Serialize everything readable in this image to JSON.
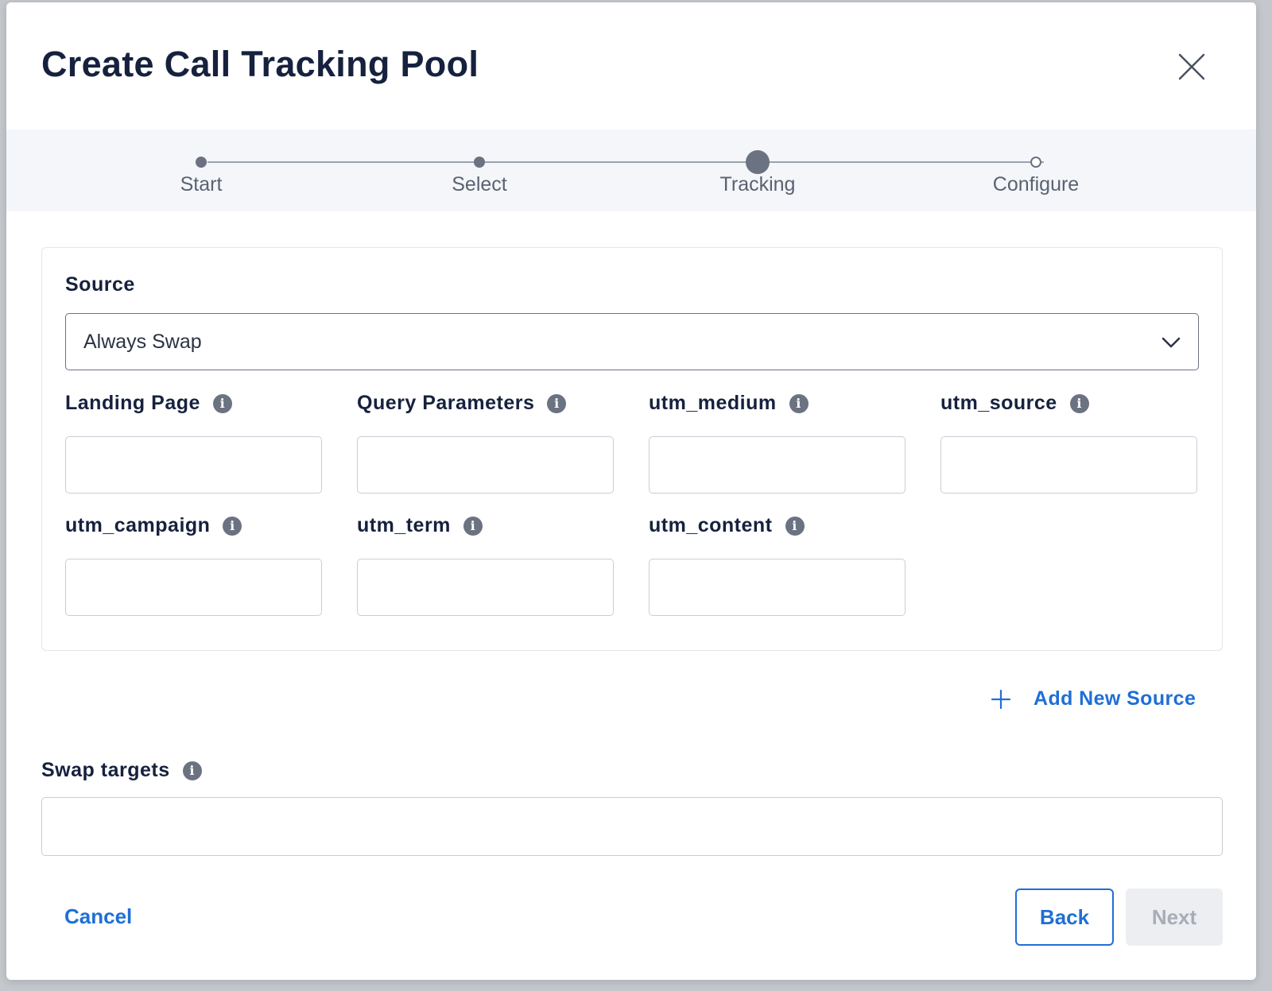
{
  "modal": {
    "title": "Create Call Tracking Pool"
  },
  "stepper": {
    "steps": [
      {
        "label": "Start",
        "state": "done"
      },
      {
        "label": "Select",
        "state": "done"
      },
      {
        "label": "Tracking",
        "state": "active"
      },
      {
        "label": "Configure",
        "state": "todo"
      }
    ]
  },
  "source": {
    "label": "Source",
    "selected": "Always Swap"
  },
  "fields": {
    "landing_page": {
      "label": "Landing Page",
      "value": ""
    },
    "query_parameters": {
      "label": "Query Parameters",
      "value": ""
    },
    "utm_medium": {
      "label": "utm_medium",
      "value": ""
    },
    "utm_source": {
      "label": "utm_source",
      "value": ""
    },
    "utm_campaign": {
      "label": "utm_campaign",
      "value": ""
    },
    "utm_term": {
      "label": "utm_term",
      "value": ""
    },
    "utm_content": {
      "label": "utm_content",
      "value": ""
    }
  },
  "add_source_label": "Add New Source",
  "swap_targets": {
    "label": "Swap targets",
    "value": ""
  },
  "footer": {
    "cancel_label": "Cancel",
    "back_label": "Back",
    "next_label": "Next"
  },
  "colors": {
    "accent": "#1f6fd6",
    "title": "#16213e",
    "muted": "#6b7281"
  },
  "icons": {
    "close": "close-icon",
    "info": "info-icon",
    "chevron": "chevron-down-icon",
    "plus": "plus-icon"
  }
}
